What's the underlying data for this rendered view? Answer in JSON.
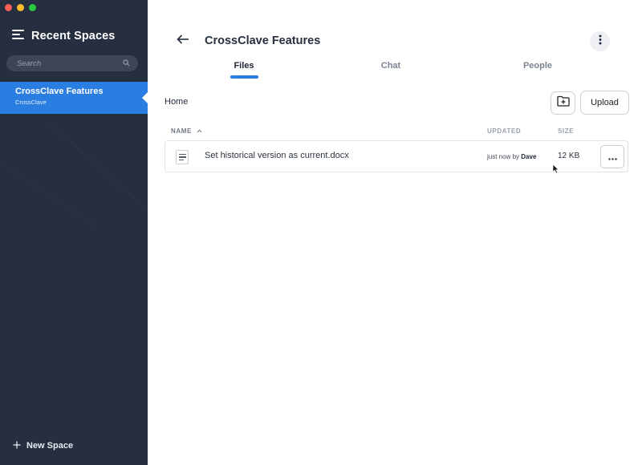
{
  "sidebar": {
    "title": "Recent Spaces",
    "search_placeholder": "Search",
    "spaces": [
      {
        "name": "CrossClave Features",
        "org": "CrossClave"
      }
    ],
    "new_space_label": "New Space",
    "icons": {
      "menu": "menu-lines-icon",
      "search": "magnifier-icon",
      "add": "plus-icon"
    }
  },
  "header": {
    "title": "CrossClave Features",
    "icons": {
      "back": "arrow-left-icon",
      "more": "vertical-dots-icon"
    }
  },
  "tabs": [
    {
      "label": "Files",
      "active": true
    },
    {
      "label": "Chat",
      "active": false
    },
    {
      "label": "People",
      "active": false
    }
  ],
  "breadcrumb": "Home",
  "toolbar": {
    "upload_label": "Upload",
    "new_folder_icon": "folder-plus-icon"
  },
  "table": {
    "columns": {
      "name": "NAME",
      "updated": "UPDATED",
      "size": "SIZE"
    },
    "rows": [
      {
        "name": "Set historical version as current.docx",
        "updated_prefix": "just now by",
        "updated_by": "Dave",
        "size": "12 KB",
        "icon": "document-icon"
      }
    ]
  },
  "colors": {
    "sidebar_bg": "#252f40",
    "accent": "#2a7de1",
    "selected_item": "#2a7de1"
  }
}
